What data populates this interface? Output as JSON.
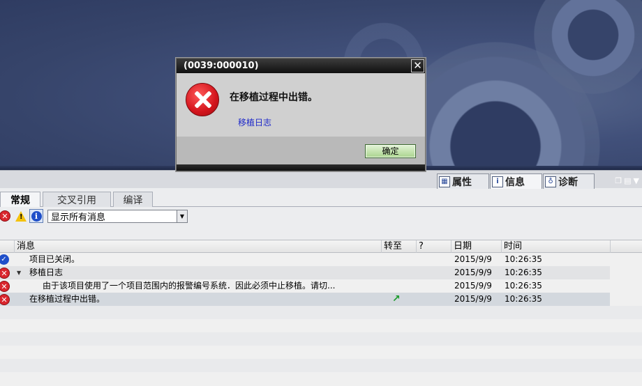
{
  "dialog": {
    "title": "(0039:000010)",
    "close_icon": "close-icon",
    "message": "在移植过程中出错。",
    "link": "移植日志",
    "ok_label": "确定"
  },
  "inspector_tabs": [
    {
      "label": "属性",
      "icon": "properties-icon"
    },
    {
      "label": "信息",
      "icon": "info-icon",
      "active": true
    },
    {
      "label": "诊断",
      "icon": "diagnostics-icon"
    }
  ],
  "sub_tabs": [
    {
      "label": "常规",
      "active": true
    },
    {
      "label": "交叉引用"
    },
    {
      "label": "编译"
    }
  ],
  "filter": {
    "selected": "显示所有消息"
  },
  "table": {
    "headers": {
      "message": "消息",
      "goto": "转至",
      "question": "?",
      "date": "日期",
      "time": "时间"
    },
    "rows": [
      {
        "icon": "check-icon",
        "message": "项目已关闭。",
        "goto": "",
        "date": "2015/9/9",
        "time": "10:26:35"
      },
      {
        "icon": "error-icon",
        "expander": "▼",
        "message": "移植日志",
        "goto": "",
        "date": "2015/9/9",
        "time": "10:26:35"
      },
      {
        "icon": "error-icon",
        "message": "由于该项目使用了一个项目范围内的报警编号系统．因此必须中止移植。请切...",
        "goto": "",
        "date": "2015/9/9",
        "time": "10:26:35"
      },
      {
        "icon": "error-icon",
        "message": "在移植过程中出错。",
        "goto": "↗",
        "date": "2015/9/9",
        "time": "10:26:35"
      }
    ]
  },
  "colors": {
    "portal_bg": "#36446a",
    "error_red": "#d9262e",
    "info_blue": "#1f4fc9",
    "ok_green": "#a9d48d",
    "link_blue": "#1c27c9"
  }
}
